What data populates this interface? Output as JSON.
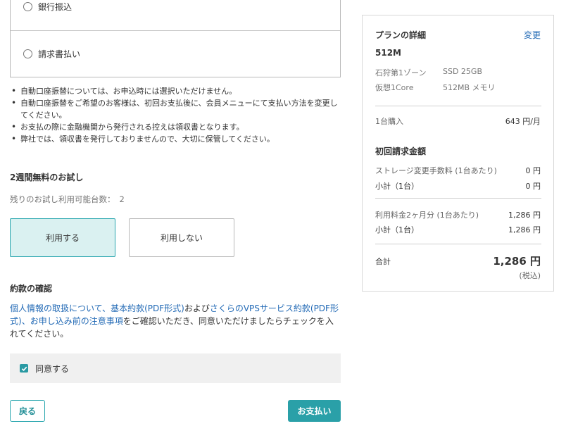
{
  "payment_options": {
    "bank_transfer": "銀行振込",
    "invoice": "請求書払い"
  },
  "notes": [
    "自動口座振替については、お申込時には選択いただけません。",
    "自動口座振替をご希望のお客様は、初回お支払後に、会員メニューにて支払い方法を変更してください。",
    "お支払の際に金融機関から発行される控えは領収書となります。",
    "弊社では、領収書を発行しておりませんので、大切に保管してください。"
  ],
  "trial": {
    "title": "2週間無料のお試し",
    "remaining_label": "残りのお試し利用可能台数：",
    "remaining_value": "2",
    "use_label": "利用する",
    "no_use_label": "利用しない"
  },
  "terms": {
    "title": "約款の確認",
    "link1": "個人情報の取扱について",
    "sep1": "、",
    "link2": "基本約款(PDF形式)",
    "and": "および",
    "link3": "さくらのVPSサービス約款(PDF形式)",
    "sep2": "、",
    "link4": "お申し込み前の注意事項",
    "rest": "をご確認いただき、同意いただけましたらチェックを入れてください。",
    "agree_label": "同意する"
  },
  "buttons": {
    "back": "戻る",
    "pay": "お支払い"
  },
  "plan": {
    "title": "プランの詳細",
    "change": "変更",
    "name": "512M",
    "specs": [
      {
        "key": "石狩第1ゾーン",
        "value": "SSD 25GB"
      },
      {
        "key": "仮想1Core",
        "value": "512MB メモリ"
      }
    ],
    "purchase_label": "1台購入",
    "purchase_price": "643 円/月",
    "initial_title": "初回請求金額",
    "storage_fee_label": "ストレージ変更手数料 (1台あたり)",
    "storage_fee_value": "0 円",
    "subtotal1_label": "小計（1台）",
    "subtotal1_value": "0 円",
    "usage_fee_label": "利用料金2ヶ月分 (1台あたり)",
    "usage_fee_value": "1,286 円",
    "subtotal2_label": "小計（1台）",
    "subtotal2_value": "1,286 円",
    "total_label": "合計",
    "total_value": "1,286 円",
    "tax_note": "(税込)"
  },
  "colors": {
    "accent": "#2aa0a8",
    "link": "#2169b5",
    "selected_bg": "#daf1f1"
  }
}
